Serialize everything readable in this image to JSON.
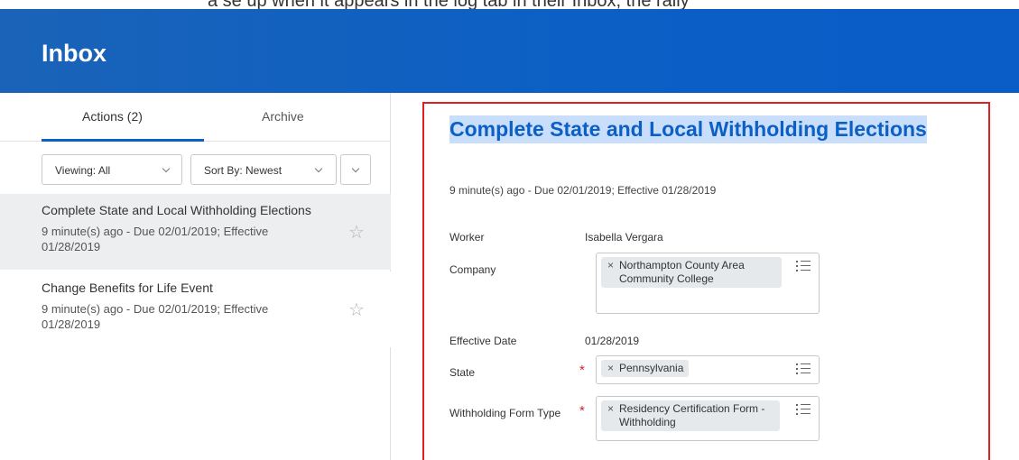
{
  "top_strip": {
    "text": "a   se up when it appears in the log tab in their Inbox, the rally"
  },
  "header": {
    "title": "Inbox"
  },
  "tabs": {
    "actions": "Actions (2)",
    "archive": "Archive"
  },
  "filters": {
    "viewing": "Viewing: All",
    "sort": "Sort By: Newest"
  },
  "inbox_items": [
    {
      "title": "Complete State and Local Withholding Elections",
      "meta": "9 minute(s) ago - Due 02/01/2019; Effective 01/28/2019"
    },
    {
      "title": "Change Benefits for Life Event",
      "meta": "9 minute(s) ago - Due 02/01/2019; Effective 01/28/2019"
    }
  ],
  "detail": {
    "title": "Complete State and Local Withholding Elections",
    "meta": "9 minute(s) ago - Due 02/01/2019; Effective 01/28/2019",
    "worker_label": "Worker",
    "worker_value": "Isabella Vergara",
    "company_label": "Company",
    "company_value": "Northampton County Area Community College",
    "effective_date_label": "Effective Date",
    "effective_date_value": "01/28/2019",
    "state_label": "State",
    "state_value": "Pennsylvania",
    "form_type_label": "Withholding Form Type",
    "form_type_value": "Residency Certification Form - Withholding",
    "required_mark": "*",
    "remove_mark": "×"
  },
  "colors": {
    "header_blue": "#0b5fc5",
    "highlight": "#c9defa",
    "frame_red": "#e02020",
    "required_red": "#d8232a"
  }
}
